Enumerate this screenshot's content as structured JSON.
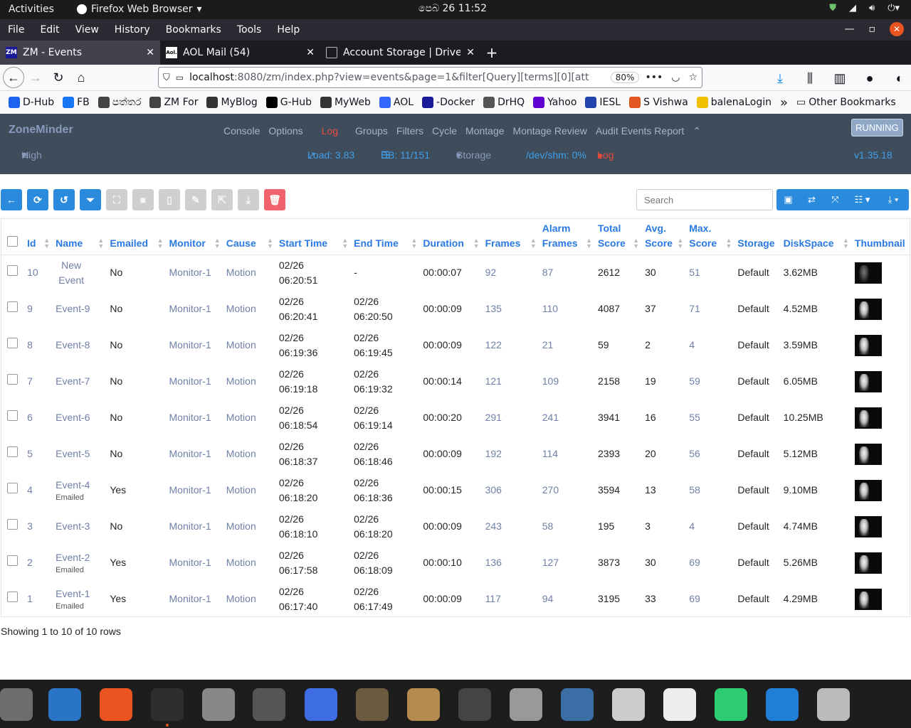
{
  "gnome": {
    "activities": "Activities",
    "app_name": "Firefox Web Browser",
    "clock": "පෙබ   26  11:52"
  },
  "menubar": [
    "File",
    "Edit",
    "View",
    "History",
    "Bookmarks",
    "Tools",
    "Help"
  ],
  "tabs": [
    {
      "label": "ZM - Events",
      "icon": "ZM",
      "active": true
    },
    {
      "label": "AOL Mail (54)",
      "icon": "Aol.",
      "active": false
    },
    {
      "label": "Account Storage | DriveH",
      "icon": "box",
      "active": false
    }
  ],
  "url": {
    "host": "localhost",
    "rest": ":8080/zm/index.php?view=events&page=1&filter[Query][terms][0][att",
    "zoom": "80%"
  },
  "bookmarks": [
    {
      "label": "D-Hub",
      "icon": "docker-icon",
      "color": "#1d63ed"
    },
    {
      "label": "FB",
      "icon": "facebook-icon",
      "color": "#1877f2"
    },
    {
      "label": "පත්තර",
      "icon": "globe-icon",
      "color": "#444444"
    },
    {
      "label": "ZM For",
      "icon": "globe-icon",
      "color": "#444444"
    },
    {
      "label": "MyBlog",
      "icon": "image-icon",
      "color": "#333333"
    },
    {
      "label": "G-Hub",
      "icon": "github-icon",
      "color": "#000000"
    },
    {
      "label": "MyWeb",
      "icon": "w-icon",
      "color": "#333333"
    },
    {
      "label": "AOL",
      "icon": "aol-icon",
      "color": "#3366ff"
    },
    {
      "label": "-Docker",
      "icon": "zm-icon",
      "color": "#1a1a99"
    },
    {
      "label": "DrHQ",
      "icon": "drhq-icon",
      "color": "#555555"
    },
    {
      "label": "Yahoo",
      "icon": "yahoo-icon",
      "color": "#6001d2"
    },
    {
      "label": "IESL",
      "icon": "iesl-icon",
      "color": "#2244aa"
    },
    {
      "label": "S Vishwa",
      "icon": "s-icon",
      "color": "#e25822"
    },
    {
      "label": "balenaLogin",
      "icon": "balena-icon",
      "color": "#f0c000"
    }
  ],
  "bookmarks_more": "»",
  "bookmarks_other": "Other Bookmarks",
  "zm": {
    "brand": "ZoneMinder",
    "nav": [
      "Console",
      "Options",
      "Log",
      "Groups",
      "Filters",
      "Cycle",
      "Montage",
      "Montage Review",
      "Audit Events Report"
    ],
    "active_nav": "Log",
    "running": "RUNNING",
    "bandwidth": "High",
    "load": "Load: 3.83",
    "db": "DB: 11/151",
    "storage": "Storage",
    "shm": "/dev/shm: 0%",
    "log": "Log",
    "version": "v1.35.18"
  },
  "search": {
    "placeholder": "Search"
  },
  "columns": [
    {
      "l1": "",
      "l2": "Id"
    },
    {
      "l1": "",
      "l2": "Name"
    },
    {
      "l1": "",
      "l2": "Emailed"
    },
    {
      "l1": "",
      "l2": "Monitor"
    },
    {
      "l1": "",
      "l2": "Cause"
    },
    {
      "l1": "",
      "l2": "Start Time"
    },
    {
      "l1": "",
      "l2": "End Time"
    },
    {
      "l1": "",
      "l2": "Duration"
    },
    {
      "l1": "",
      "l2": "Frames"
    },
    {
      "l1": "Alarm",
      "l2": "Frames"
    },
    {
      "l1": "Total",
      "l2": "Score"
    },
    {
      "l1": "Avg.",
      "l2": "Score"
    },
    {
      "l1": "Max.",
      "l2": "Score"
    },
    {
      "l1": "",
      "l2": "Storage"
    },
    {
      "l1": "",
      "l2": "DiskSpace"
    },
    {
      "l1": "",
      "l2": "Thumbnail"
    }
  ],
  "events": [
    {
      "id": "10",
      "name": "New Event",
      "name_sub": "",
      "emailed": "No",
      "monitor": "Monitor-1",
      "cause": "Motion",
      "start_date": "02/26",
      "start_time": "06:20:51",
      "end_date": "",
      "end_time": "-",
      "duration": "00:00:07",
      "frames": "92",
      "alarm_frames": "87",
      "total": "2612",
      "avg": "30",
      "max": "51",
      "storage": "Default",
      "disk": "3.62MB"
    },
    {
      "id": "9",
      "name": "Event-9",
      "name_sub": "",
      "emailed": "No",
      "monitor": "Monitor-1",
      "cause": "Motion",
      "start_date": "02/26",
      "start_time": "06:20:41",
      "end_date": "02/26",
      "end_time": "06:20:50",
      "duration": "00:00:09",
      "frames": "135",
      "alarm_frames": "110",
      "total": "4087",
      "avg": "37",
      "max": "71",
      "storage": "Default",
      "disk": "4.52MB"
    },
    {
      "id": "8",
      "name": "Event-8",
      "name_sub": "",
      "emailed": "No",
      "monitor": "Monitor-1",
      "cause": "Motion",
      "start_date": "02/26",
      "start_time": "06:19:36",
      "end_date": "02/26",
      "end_time": "06:19:45",
      "duration": "00:00:09",
      "frames": "122",
      "alarm_frames": "21",
      "total": "59",
      "avg": "2",
      "max": "4",
      "storage": "Default",
      "disk": "3.59MB"
    },
    {
      "id": "7",
      "name": "Event-7",
      "name_sub": "",
      "emailed": "No",
      "monitor": "Monitor-1",
      "cause": "Motion",
      "start_date": "02/26",
      "start_time": "06:19:18",
      "end_date": "02/26",
      "end_time": "06:19:32",
      "duration": "00:00:14",
      "frames": "121",
      "alarm_frames": "109",
      "total": "2158",
      "avg": "19",
      "max": "59",
      "storage": "Default",
      "disk": "6.05MB"
    },
    {
      "id": "6",
      "name": "Event-6",
      "name_sub": "",
      "emailed": "No",
      "monitor": "Monitor-1",
      "cause": "Motion",
      "start_date": "02/26",
      "start_time": "06:18:54",
      "end_date": "02/26",
      "end_time": "06:19:14",
      "duration": "00:00:20",
      "frames": "291",
      "alarm_frames": "241",
      "total": "3941",
      "avg": "16",
      "max": "55",
      "storage": "Default",
      "disk": "10.25MB"
    },
    {
      "id": "5",
      "name": "Event-5",
      "name_sub": "",
      "emailed": "No",
      "monitor": "Monitor-1",
      "cause": "Motion",
      "start_date": "02/26",
      "start_time": "06:18:37",
      "end_date": "02/26",
      "end_time": "06:18:46",
      "duration": "00:00:09",
      "frames": "192",
      "alarm_frames": "114",
      "total": "2393",
      "avg": "20",
      "max": "56",
      "storage": "Default",
      "disk": "5.12MB"
    },
    {
      "id": "4",
      "name": "Event-4",
      "name_sub": "Emailed",
      "emailed": "Yes",
      "monitor": "Monitor-1",
      "cause": "Motion",
      "start_date": "02/26",
      "start_time": "06:18:20",
      "end_date": "02/26",
      "end_time": "06:18:36",
      "duration": "00:00:15",
      "frames": "306",
      "alarm_frames": "270",
      "total": "3594",
      "avg": "13",
      "max": "58",
      "storage": "Default",
      "disk": "9.10MB"
    },
    {
      "id": "3",
      "name": "Event-3",
      "name_sub": "",
      "emailed": "No",
      "monitor": "Monitor-1",
      "cause": "Motion",
      "start_date": "02/26",
      "start_time": "06:18:10",
      "end_date": "02/26",
      "end_time": "06:18:20",
      "duration": "00:00:09",
      "frames": "243",
      "alarm_frames": "58",
      "total": "195",
      "avg": "3",
      "max": "4",
      "storage": "Default",
      "disk": "4.74MB"
    },
    {
      "id": "2",
      "name": "Event-2",
      "name_sub": "Emailed",
      "emailed": "Yes",
      "monitor": "Monitor-1",
      "cause": "Motion",
      "start_date": "02/26",
      "start_time": "06:17:58",
      "end_date": "02/26",
      "end_time": "06:18:09",
      "duration": "00:00:10",
      "frames": "136",
      "alarm_frames": "127",
      "total": "3873",
      "avg": "30",
      "max": "69",
      "storage": "Default",
      "disk": "5.26MB"
    },
    {
      "id": "1",
      "name": "Event-1",
      "name_sub": "Emailed",
      "emailed": "Yes",
      "monitor": "Monitor-1",
      "cause": "Motion",
      "start_date": "02/26",
      "start_time": "06:17:40",
      "end_date": "02/26",
      "end_time": "06:17:49",
      "duration": "00:00:09",
      "frames": "117",
      "alarm_frames": "94",
      "total": "3195",
      "avg": "33",
      "max": "69",
      "storage": "Default",
      "disk": "4.29MB"
    }
  ],
  "footer": "Showing 1 to 10 of 10 rows",
  "dock": [
    {
      "name": "files-icon",
      "color": "#6d6d6d"
    },
    {
      "name": "libreoffice-impress-icon",
      "color": "#2a74c6"
    },
    {
      "name": "software-center-icon",
      "color": "#e95420"
    },
    {
      "name": "terminal-icon",
      "color": "#2e2e2e"
    },
    {
      "name": "users-icon",
      "color": "#888888"
    },
    {
      "name": "vmware-icon",
      "color": "#555555"
    },
    {
      "name": "screenshot-icon",
      "color": "#3d6de0"
    },
    {
      "name": "gimp-icon",
      "color": "#6a5a40"
    },
    {
      "name": "archive-manager-icon",
      "color": "#b58a4e"
    },
    {
      "name": "app-store-icon",
      "color": "#444444"
    },
    {
      "name": "disks-icon",
      "color": "#999999"
    },
    {
      "name": "video-editor-icon",
      "color": "#3a6ea5"
    },
    {
      "name": "dictionary-icon",
      "color": "#cccccc"
    },
    {
      "name": "text-editor-icon",
      "color": "#eeeeee"
    },
    {
      "name": "power-manager-icon",
      "color": "#2ecc71"
    },
    {
      "name": "vscode-icon",
      "color": "#1f7fd6"
    },
    {
      "name": "disc-icon",
      "color": "#bbbbbb"
    },
    {
      "name": "app-grid-icon",
      "color": "#1d1d1d"
    }
  ]
}
